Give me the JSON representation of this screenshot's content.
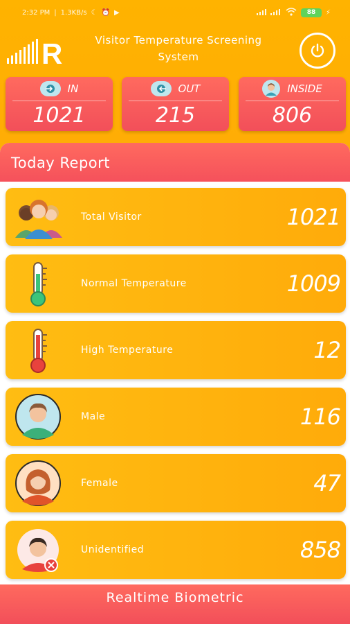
{
  "status_bar": {
    "time": "2:32 PM",
    "speed": "1.3KB/s",
    "battery": "88"
  },
  "header": {
    "title": "Visitor Temperature Screening System",
    "logo_letter": "R"
  },
  "counters": [
    {
      "label": "IN",
      "value": "1021",
      "icon": "enter-icon"
    },
    {
      "label": "OUT",
      "value": "215",
      "icon": "exit-icon"
    },
    {
      "label": "INSIDE",
      "value": "806",
      "icon": "person-icon"
    }
  ],
  "report": {
    "title": "Today Report",
    "items": [
      {
        "label": "Total Visitor",
        "value": "1021",
        "icon": "group-icon"
      },
      {
        "label": "Normal Temperature",
        "value": "1009",
        "icon": "thermometer-normal-icon"
      },
      {
        "label": "High Temperature",
        "value": "12",
        "icon": "thermometer-high-icon"
      },
      {
        "label": "Male",
        "value": "116",
        "icon": "male-avatar-icon"
      },
      {
        "label": "Female",
        "value": "47",
        "icon": "female-avatar-icon"
      },
      {
        "label": "Unidentified",
        "value": "858",
        "icon": "unidentified-avatar-icon"
      }
    ]
  },
  "bottom_bar": {
    "label": "Realtime Biometric"
  },
  "colors": {
    "background": "#ffb300",
    "accent_red": "#f55a5c",
    "card": "#ffb10d",
    "normal_green": "#3cc47a",
    "high_red": "#e8423d"
  }
}
